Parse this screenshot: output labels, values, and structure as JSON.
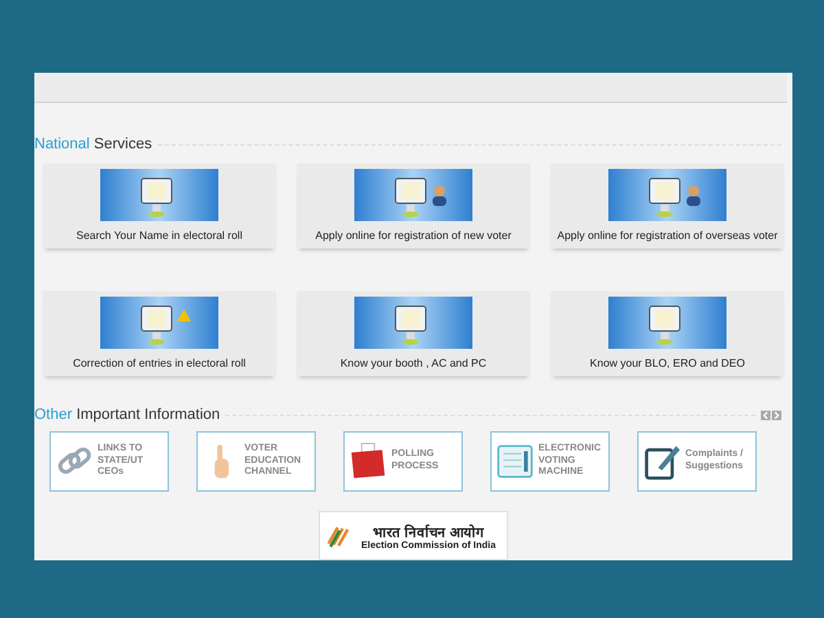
{
  "national_services": {
    "heading": {
      "accent": "National",
      "rest": "Services"
    },
    "items": [
      {
        "caption": "Search Your Name in electoral roll"
      },
      {
        "caption": "Apply online for registration of new voter"
      },
      {
        "caption": "Apply online for registration of overseas voter"
      },
      {
        "caption": "Correction of entries in electoral roll"
      },
      {
        "caption": "Know your booth , AC and PC"
      },
      {
        "caption": "Know your BLO, ERO and DEO"
      }
    ]
  },
  "other_information": {
    "heading": {
      "accent": "Other",
      "rest": "Important Information"
    },
    "items": [
      {
        "kind": "links",
        "label": "LINKS TO STATE/UT CEOs"
      },
      {
        "kind": "education",
        "label": "VOTER EDUCATION CHANNEL"
      },
      {
        "kind": "polling",
        "label": "POLLING PROCESS"
      },
      {
        "kind": "evm",
        "label": "ELECTRONIC VOTING MACHINE"
      },
      {
        "kind": "complaints",
        "label": "Complaints / Suggestions"
      }
    ]
  },
  "logo": {
    "hindi": "भारत निर्वाचन आयोग",
    "english": "Election Commission of India"
  }
}
